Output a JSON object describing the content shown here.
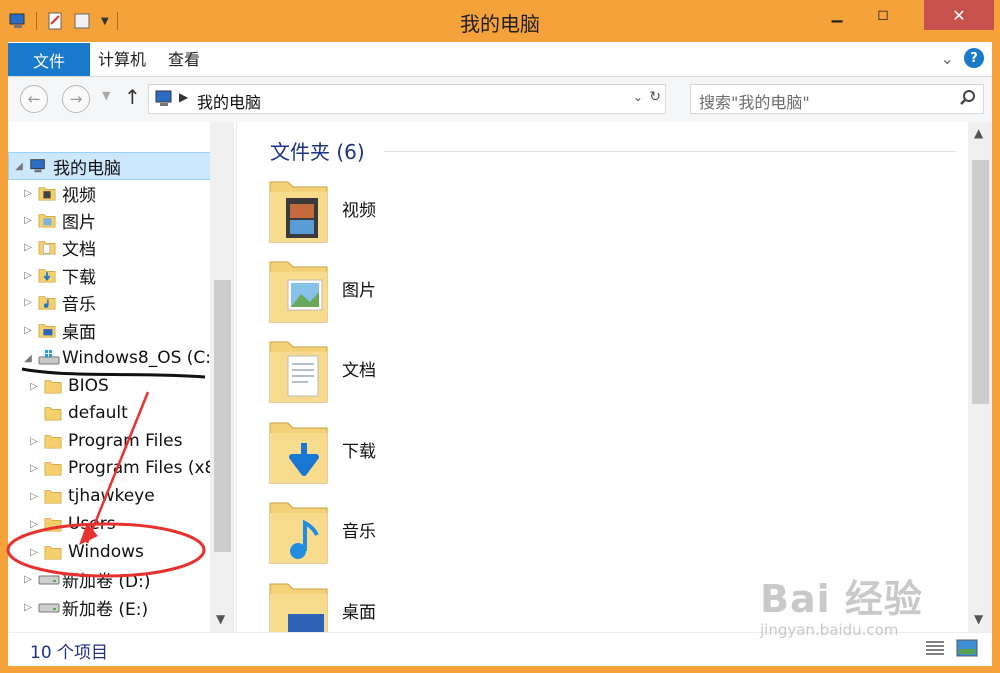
{
  "window": {
    "title": "我的电脑"
  },
  "ribbon": {
    "tabs": [
      "文件",
      "计算机",
      "查看"
    ]
  },
  "address": {
    "path": "我的电脑",
    "search_placeholder": "搜索\"我的电脑\""
  },
  "nav": {
    "items": [
      {
        "label": "我的电脑",
        "icon": "computer-icon",
        "expanded": true,
        "selected": true,
        "indent": 0
      },
      {
        "label": "视频",
        "icon": "videos-folder-icon",
        "indent": 1
      },
      {
        "label": "图片",
        "icon": "pictures-folder-icon",
        "indent": 1
      },
      {
        "label": "文档",
        "icon": "documents-folder-icon",
        "indent": 1
      },
      {
        "label": "下载",
        "icon": "downloads-folder-icon",
        "indent": 1
      },
      {
        "label": "音乐",
        "icon": "music-folder-icon",
        "indent": 1
      },
      {
        "label": "桌面",
        "icon": "desktop-folder-icon",
        "indent": 1
      },
      {
        "label": "Windows8_OS (C:",
        "icon": "windows-drive-icon",
        "expanded": true,
        "indent": 1
      },
      {
        "label": "BIOS",
        "icon": "folder-icon",
        "indent": 2
      },
      {
        "label": "default",
        "icon": "folder-icon",
        "indent": 2,
        "no_arrow": true
      },
      {
        "label": "Program Files",
        "icon": "folder-icon",
        "indent": 2
      },
      {
        "label": "Program Files (x8",
        "icon": "folder-icon",
        "indent": 2
      },
      {
        "label": "tjhawkeye",
        "icon": "folder-icon",
        "indent": 2
      },
      {
        "label": "Users",
        "icon": "folder-icon",
        "indent": 2
      },
      {
        "label": "Windows",
        "icon": "folder-icon",
        "indent": 2,
        "hover": true
      },
      {
        "label": "新加卷 (D:)",
        "icon": "drive-icon",
        "indent": 1
      },
      {
        "label": "新加卷 (E:)",
        "icon": "drive-icon",
        "indent": 1
      }
    ]
  },
  "main": {
    "group_heading": "文件夹 (6)",
    "folders": [
      {
        "label": "视频",
        "icon": "videos-folder-icon"
      },
      {
        "label": "图片",
        "icon": "pictures-folder-icon"
      },
      {
        "label": "文档",
        "icon": "documents-folder-icon"
      },
      {
        "label": "下载",
        "icon": "downloads-folder-icon"
      },
      {
        "label": "音乐",
        "icon": "music-folder-icon"
      },
      {
        "label": "桌面",
        "icon": "desktop-folder-icon"
      }
    ]
  },
  "status": {
    "count": "10 个项目"
  },
  "watermark": {
    "brand": "Bai 经验",
    "url": "jingyan.baidu.com"
  },
  "colors": {
    "titlebar": "#f6a23a",
    "accent": "#1979ca",
    "selection": "#cce8ff",
    "annotation": "#e8322f"
  }
}
